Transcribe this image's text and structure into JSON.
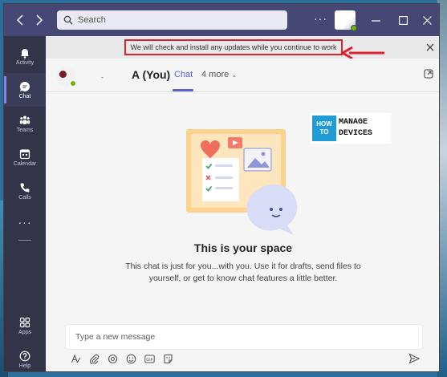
{
  "titlebar": {
    "back_icon": "chevron-left-icon",
    "forward_icon": "chevron-right-icon",
    "search_placeholder": "Search",
    "more_label": "···"
  },
  "rail": {
    "items": [
      {
        "label": "Activity",
        "icon": "bell-icon"
      },
      {
        "label": "Chat",
        "icon": "chat-icon",
        "active": true
      },
      {
        "label": "Teams",
        "icon": "teams-icon"
      },
      {
        "label": "Calendar",
        "icon": "calendar-icon"
      },
      {
        "label": "Calls",
        "icon": "phone-icon"
      }
    ],
    "more_label": "···",
    "bottom_items": [
      {
        "label": "Apps",
        "icon": "apps-icon"
      },
      {
        "label": "Help",
        "icon": "help-icon"
      }
    ]
  },
  "banner": {
    "text": "We will check and install any updates while you continue to work"
  },
  "header": {
    "name_fragment": "-",
    "name": "A (You)",
    "tab_chat": "Chat",
    "tab_more": "4 more"
  },
  "watermark": {
    "left_top": "HOW",
    "left_bottom": "TO",
    "right_top": "MANAGE",
    "right_bottom": "DEVICES"
  },
  "main": {
    "title": "This is your space",
    "description": "This chat is just for you...with you. Use it for drafts, send files to yourself, or get to know chat features a little better."
  },
  "compose": {
    "placeholder": "Type a new message",
    "gif_label": "GIF"
  },
  "colors": {
    "titlebar": "#464775",
    "rail": "#33344a",
    "accent": "#5b5fc7",
    "annotation_red": "#e0202a",
    "presence_green": "#6bb700"
  }
}
